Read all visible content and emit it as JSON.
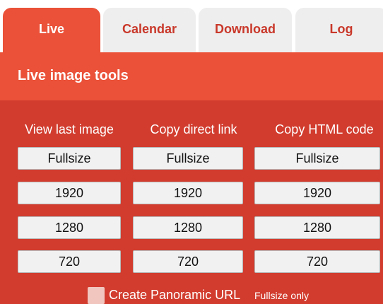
{
  "tabs": [
    {
      "label": "Live",
      "active": true
    },
    {
      "label": "Calendar",
      "active": false
    },
    {
      "label": "Download",
      "active": false
    },
    {
      "label": "Log",
      "active": false
    }
  ],
  "panel": {
    "title": "Live image tools"
  },
  "columns": [
    {
      "heading": "View last image",
      "buttons": [
        "Fullsize",
        "1920",
        "1280",
        "720"
      ]
    },
    {
      "heading": "Copy direct link",
      "buttons": [
        "Fullsize",
        "1920",
        "1280",
        "720"
      ]
    },
    {
      "heading": "Copy HTML code",
      "buttons": [
        "Fullsize",
        "1920",
        "1280",
        "720"
      ]
    }
  ],
  "panorama": {
    "label": "Create Panoramic URL",
    "note": "Fullsize only",
    "checked": false
  },
  "colors": {
    "accent": "#ea5138",
    "body": "#d13c2e",
    "tab_inactive_bg": "#eeeeee",
    "tab_inactive_text": "#c9382a"
  }
}
